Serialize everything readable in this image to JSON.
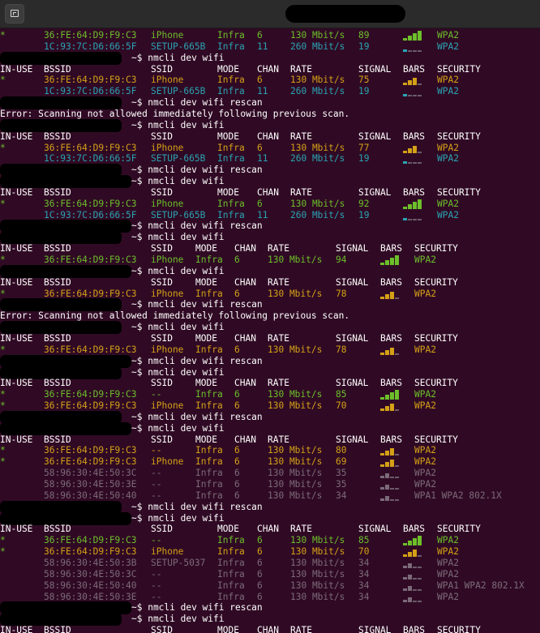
{
  "colors": {
    "background": "#300a24",
    "text": "#ffffff",
    "orange": "#d4a017",
    "teal": "#2aa3b3",
    "green": "#6cbf2a",
    "gray": "#7c6a79",
    "bar_dim": "#6b5a6a",
    "red": "#ee5555",
    "yellow": "#d4b000"
  },
  "columns_x": {
    "inuse": 0,
    "bssid": 54,
    "ssid_a": 186,
    "mode_a": 268,
    "chan_a": 317,
    "rate_a": 358,
    "signal_a": 442,
    "bars_a": 497,
    "security_a": 539,
    "ssid_b": 186,
    "mode_b": 241,
    "chan_b": 289,
    "rate_b": 330,
    "signal_b": 414,
    "bars_b": 469,
    "security_b": 511
  },
  "lines": [
    {
      "type": "row",
      "layout": "a",
      "inuse": "*",
      "bssid": "36:FE:64:D9:F9:C3",
      "ssid": "iPhone",
      "mode": "Infra",
      "chan": "6",
      "rate": "130 Mbit/s",
      "signal": "89",
      "bars": "▂▄▆█",
      "security": "WPA2",
      "color": "green"
    },
    {
      "type": "row",
      "layout": "a",
      "inuse": "",
      "bssid": "1C:93:7C:D6:66:5F",
      "ssid": "SETUP-665B",
      "mode": "Infra",
      "chan": "11",
      "rate": "260 Mbit/s",
      "signal": "19",
      "bars": "▂___",
      "security": "WPA2",
      "color": "teal"
    },
    {
      "type": "cmd",
      "text": "~$ nmcli dev wifi"
    },
    {
      "type": "header",
      "layout": "a",
      "inuse": "IN-USE",
      "bssid": "BSSID",
      "ssid": "SSID",
      "mode": "MODE",
      "chan": "CHAN",
      "rate": "RATE",
      "signal": "SIGNAL",
      "bars": "BARS",
      "security": "SECURITY"
    },
    {
      "type": "row",
      "layout": "a",
      "inuse": "*",
      "bssid": "36:FE:64:D9:F9:C3",
      "ssid": "iPhone",
      "mode": "Infra",
      "chan": "6",
      "rate": "130 Mbit/s",
      "signal": "75",
      "bars": "▂▄▆_",
      "security": "WPA2",
      "color": "orange"
    },
    {
      "type": "row",
      "layout": "a",
      "inuse": "",
      "bssid": "1C:93:7C:D6:66:5F",
      "ssid": "SETUP-665B",
      "mode": "Infra",
      "chan": "11",
      "rate": "260 Mbit/s",
      "signal": "19",
      "bars": "▂___",
      "security": "WPA2",
      "color": "teal"
    },
    {
      "type": "cmd",
      "text": "~$ nmcli dev wifi rescan"
    },
    {
      "type": "error",
      "text": "Error: Scanning not allowed immediately following previous scan."
    },
    {
      "type": "cmd",
      "text": "~$ nmcli dev wifi"
    },
    {
      "type": "header",
      "layout": "a",
      "inuse": "IN-USE",
      "bssid": "BSSID",
      "ssid": "SSID",
      "mode": "MODE",
      "chan": "CHAN",
      "rate": "RATE",
      "signal": "SIGNAL",
      "bars": "BARS",
      "security": "SECURITY"
    },
    {
      "type": "row",
      "layout": "a",
      "inuse": "*",
      "bssid": "36:FE:64:D9:F9:C3",
      "ssid": "iPhone",
      "mode": "Infra",
      "chan": "6",
      "rate": "130 Mbit/s",
      "signal": "77",
      "bars": "▂▄▆_",
      "security": "WPA2",
      "color": "orange"
    },
    {
      "type": "row",
      "layout": "a",
      "inuse": "",
      "bssid": "1C:93:7C:D6:66:5F",
      "ssid": "SETUP-665B",
      "mode": "Infra",
      "chan": "11",
      "rate": "260 Mbit/s",
      "signal": "19",
      "bars": "▂___",
      "security": "WPA2",
      "color": "teal"
    },
    {
      "type": "cmd",
      "text": "~$ nmcli dev wifi rescan"
    },
    {
      "type": "cmd",
      "text": "~$ nmcli dev wifi"
    },
    {
      "type": "header",
      "layout": "a",
      "inuse": "IN-USE",
      "bssid": "BSSID",
      "ssid": "SSID",
      "mode": "MODE",
      "chan": "CHAN",
      "rate": "RATE",
      "signal": "SIGNAL",
      "bars": "BARS",
      "security": "SECURITY"
    },
    {
      "type": "row",
      "layout": "a",
      "inuse": "*",
      "bssid": "36:FE:64:D9:F9:C3",
      "ssid": "iPhone",
      "mode": "Infra",
      "chan": "6",
      "rate": "130 Mbit/s",
      "signal": "92",
      "bars": "▂▄▆█",
      "security": "WPA2",
      "color": "green"
    },
    {
      "type": "row",
      "layout": "a",
      "inuse": "",
      "bssid": "1C:93:7C:D6:66:5F",
      "ssid": "SETUP-665B",
      "mode": "Infra",
      "chan": "11",
      "rate": "260 Mbit/s",
      "signal": "19",
      "bars": "▂___",
      "security": "WPA2",
      "color": "teal"
    },
    {
      "type": "cmd",
      "text": "~$ nmcli dev wifi rescan"
    },
    {
      "type": "cmd",
      "text": "~$ nmcli dev wifi"
    },
    {
      "type": "header",
      "layout": "b",
      "inuse": "IN-USE",
      "bssid": "BSSID",
      "ssid": "SSID",
      "mode": "MODE",
      "chan": "CHAN",
      "rate": "RATE",
      "signal": "SIGNAL",
      "bars": "BARS",
      "security": "SECURITY"
    },
    {
      "type": "row",
      "layout": "b",
      "inuse": "*",
      "bssid": "36:FE:64:D9:F9:C3",
      "ssid": "iPhone",
      "mode": "Infra",
      "chan": "6",
      "rate": "130 Mbit/s",
      "signal": "94",
      "bars": "▂▄▆█",
      "security": "WPA2",
      "color": "green"
    },
    {
      "type": "cmd",
      "text": "~$ nmcli dev wifi"
    },
    {
      "type": "header",
      "layout": "b",
      "inuse": "IN-USE",
      "bssid": "BSSID",
      "ssid": "SSID",
      "mode": "MODE",
      "chan": "CHAN",
      "rate": "RATE",
      "signal": "SIGNAL",
      "bars": "BARS",
      "security": "SECURITY"
    },
    {
      "type": "row",
      "layout": "b",
      "inuse": "*",
      "bssid": "36:FE:64:D9:F9:C3",
      "ssid": "iPhone",
      "mode": "Infra",
      "chan": "6",
      "rate": "130 Mbit/s",
      "signal": "78",
      "bars": "▂▄▆_",
      "security": "WPA2",
      "color": "orange"
    },
    {
      "type": "cmd",
      "text": "~$ nmcli dev wifi rescan"
    },
    {
      "type": "error",
      "text": "Error: Scanning not allowed immediately following previous scan."
    },
    {
      "type": "cmd",
      "text": "~$ nmcli dev wifi"
    },
    {
      "type": "header",
      "layout": "b",
      "inuse": "IN-USE",
      "bssid": "BSSID",
      "ssid": "SSID",
      "mode": "MODE",
      "chan": "CHAN",
      "rate": "RATE",
      "signal": "SIGNAL",
      "bars": "BARS",
      "security": "SECURITY"
    },
    {
      "type": "row",
      "layout": "b",
      "inuse": "*",
      "bssid": "36:FE:64:D9:F9:C3",
      "ssid": "iPhone",
      "mode": "Infra",
      "chan": "6",
      "rate": "130 Mbit/s",
      "signal": "78",
      "bars": "▂▄▆_",
      "security": "WPA2",
      "color": "orange"
    },
    {
      "type": "cmd",
      "text": "~$ nmcli dev wifi rescan"
    },
    {
      "type": "cmd",
      "text": "~$ nmcli dev wifi"
    },
    {
      "type": "header",
      "layout": "b",
      "inuse": "IN-USE",
      "bssid": "BSSID",
      "ssid": "SSID",
      "mode": "MODE",
      "chan": "CHAN",
      "rate": "RATE",
      "signal": "SIGNAL",
      "bars": "BARS",
      "security": "SECURITY"
    },
    {
      "type": "row",
      "layout": "b",
      "inuse": "*",
      "bssid": "36:FE:64:D9:F9:C3",
      "ssid": "--",
      "mode": "Infra",
      "chan": "6",
      "rate": "130 Mbit/s",
      "signal": "85",
      "bars": "▂▄▆█",
      "security": "WPA2",
      "color": "green"
    },
    {
      "type": "row",
      "layout": "b",
      "inuse": "*",
      "bssid": "36:FE:64:D9:F9:C3",
      "ssid": "iPhone",
      "mode": "Infra",
      "chan": "6",
      "rate": "130 Mbit/s",
      "signal": "70",
      "bars": "▂▄▆_",
      "security": "WPA2",
      "color": "orange"
    },
    {
      "type": "cmd",
      "text": "~$ nmcli dev wifi rescan"
    },
    {
      "type": "cmd",
      "text": "~$ nmcli dev wifi"
    },
    {
      "type": "header",
      "layout": "b",
      "inuse": "IN-USE",
      "bssid": "BSSID",
      "ssid": "SSID",
      "mode": "MODE",
      "chan": "CHAN",
      "rate": "RATE",
      "signal": "SIGNAL",
      "bars": "BARS",
      "security": "SECURITY"
    },
    {
      "type": "row",
      "layout": "b",
      "inuse": "*",
      "bssid": "36:FE:64:D9:F9:C3",
      "ssid": "--",
      "mode": "Infra",
      "chan": "6",
      "rate": "130 Mbit/s",
      "signal": "80",
      "bars": "▂▄▆_",
      "security": "WPA2",
      "color": "orange"
    },
    {
      "type": "row",
      "layout": "b",
      "inuse": "*",
      "bssid": "36:FE:64:D9:F9:C3",
      "ssid": "iPhone",
      "mode": "Infra",
      "chan": "6",
      "rate": "130 Mbit/s",
      "signal": "69",
      "bars": "▂▄▆_",
      "security": "WPA2",
      "color": "orange"
    },
    {
      "type": "row",
      "layout": "b",
      "inuse": "",
      "bssid": "58:96:30:4E:50:3C",
      "ssid": "--",
      "mode": "Infra",
      "chan": "6",
      "rate": "130 Mbit/s",
      "signal": "35",
      "bars": "▂▄__",
      "security": "WPA2",
      "color": "gray"
    },
    {
      "type": "row",
      "layout": "b",
      "inuse": "",
      "bssid": "58:96:30:4E:50:3E",
      "ssid": "--",
      "mode": "Infra",
      "chan": "6",
      "rate": "130 Mbit/s",
      "signal": "35",
      "bars": "▂▄__",
      "security": "WPA2",
      "color": "gray"
    },
    {
      "type": "row",
      "layout": "b",
      "inuse": "",
      "bssid": "58:96:30:4E:50:40",
      "ssid": "--",
      "mode": "Infra",
      "chan": "6",
      "rate": "130 Mbit/s",
      "signal": "34",
      "bars": "▂▄__",
      "security": "WPA1 WPA2 802.1X",
      "color": "gray"
    },
    {
      "type": "cmd",
      "text": "~$ nmcli dev wifi rescan"
    },
    {
      "type": "cmd",
      "text": "~$ nmcli dev wifi"
    },
    {
      "type": "header",
      "layout": "a",
      "inuse": "IN-USE",
      "bssid": "BSSID",
      "ssid": "SSID",
      "mode": "MODE",
      "chan": "CHAN",
      "rate": "RATE",
      "signal": "SIGNAL",
      "bars": "BARS",
      "security": "SECURITY"
    },
    {
      "type": "row",
      "layout": "a",
      "inuse": "*",
      "bssid": "36:FE:64:D9:F9:C3",
      "ssid": "--",
      "mode": "Infra",
      "chan": "6",
      "rate": "130 Mbit/s",
      "signal": "85",
      "bars": "▂▄▆█",
      "security": "WPA2",
      "color": "green"
    },
    {
      "type": "row",
      "layout": "a",
      "inuse": "*",
      "bssid": "36:FE:64:D9:F9:C3",
      "ssid": "iPhone",
      "mode": "Infra",
      "chan": "6",
      "rate": "130 Mbit/s",
      "signal": "70",
      "bars": "▂▄▆_",
      "security": "WPA2",
      "color": "orange"
    },
    {
      "type": "row",
      "layout": "a",
      "inuse": "",
      "bssid": "58:96:30:4E:50:3B",
      "ssid": "SETUP-5037",
      "mode": "Infra",
      "chan": "6",
      "rate": "130 Mbit/s",
      "signal": "34",
      "bars": "▂▄__",
      "security": "WPA2",
      "color": "gray"
    },
    {
      "type": "row",
      "layout": "a",
      "inuse": "",
      "bssid": "58:96:30:4E:50:3C",
      "ssid": "--",
      "mode": "Infra",
      "chan": "6",
      "rate": "130 Mbit/s",
      "signal": "34",
      "bars": "▂▄__",
      "security": "WPA2",
      "color": "gray"
    },
    {
      "type": "row",
      "layout": "a",
      "inuse": "",
      "bssid": "58:96:30:4E:50:40",
      "ssid": "--",
      "mode": "Infra",
      "chan": "6",
      "rate": "130 Mbit/s",
      "signal": "34",
      "bars": "▂▄__",
      "security": "WPA1 WPA2 802.1X",
      "color": "gray"
    },
    {
      "type": "row",
      "layout": "a",
      "inuse": "",
      "bssid": "58:96:30:4E:50:3E",
      "ssid": "--",
      "mode": "Infra",
      "chan": "6",
      "rate": "130 Mbit/s",
      "signal": "34",
      "bars": "▂▄__",
      "security": "WPA2",
      "color": "gray"
    },
    {
      "type": "cmd",
      "text": "~$ nmcli dev wifi rescan"
    },
    {
      "type": "cmd",
      "text": "~$ nmcli dev wifi"
    },
    {
      "type": "header",
      "layout": "a",
      "inuse": "IN-USE",
      "bssid": "BSSID",
      "ssid": "SSID",
      "mode": "MODE",
      "chan": "CHAN",
      "rate": "RATE",
      "signal": "SIGNAL",
      "bars": "BARS",
      "security": "SECURITY"
    }
  ]
}
